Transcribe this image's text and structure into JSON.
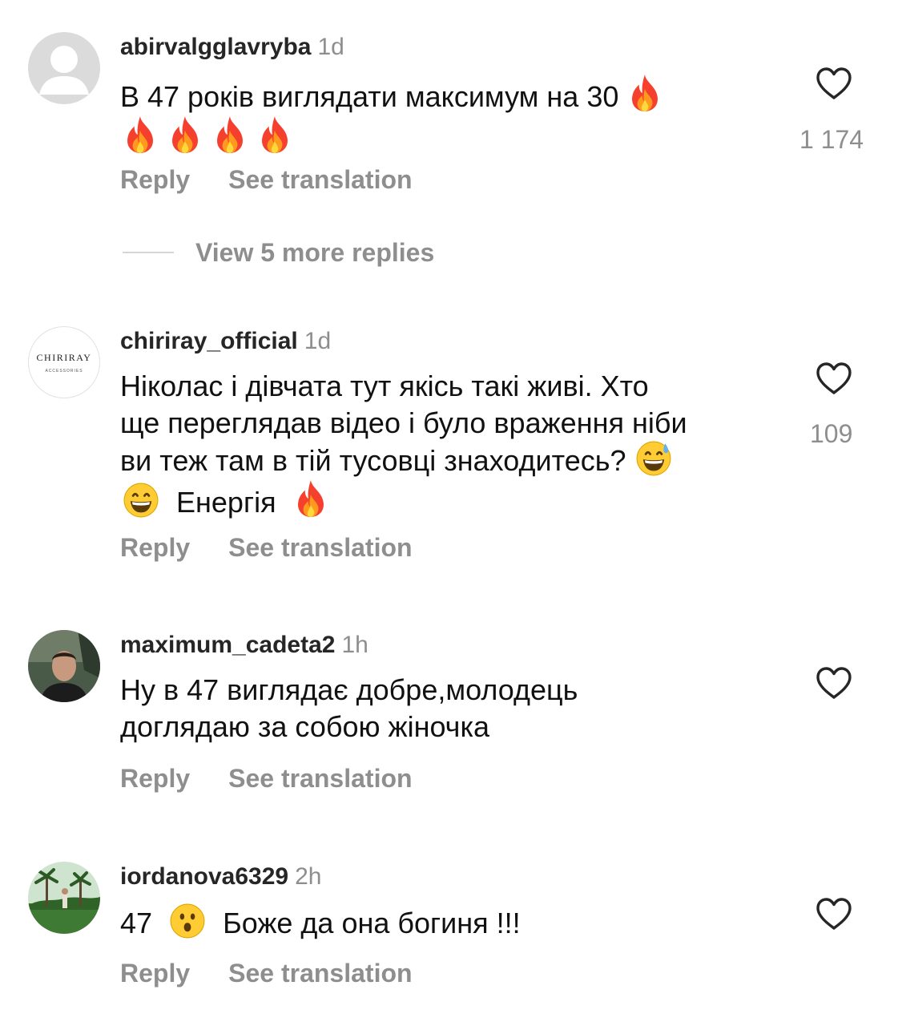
{
  "comments": [
    {
      "username": "abirvalgglavryba",
      "time": "1d",
      "text": "В 47 років виглядати максимум на 30",
      "likes": "1 174",
      "reply_label": "Reply",
      "translate_label": "See translation",
      "view_replies_label": "View 5 more replies",
      "avatar_icon": "default-profile-icon"
    },
    {
      "username": "chiriray_official",
      "time": "1d",
      "text_line1": "Ніколас і дівчата тут якісь такі живі. Хто",
      "text_line2": "ще переглядав відео і було враження ніби",
      "text_line3": "ви теж там в тій тусовці знаходитесь?",
      "text_line4": "Енергія",
      "likes": "109",
      "reply_label": "Reply",
      "translate_label": "See translation",
      "avatar_brand": "CHIRIRAY",
      "avatar_brand_sub": "ACCESSORIES"
    },
    {
      "username": "maximum_cadeta2",
      "time": "1h",
      "text_line1": "Ну в 47 виглядає добре,молодець",
      "text_line2": "доглядаю за собою жіночка",
      "reply_label": "Reply",
      "translate_label": "See translation"
    },
    {
      "username": "iordanova6329",
      "time": "2h",
      "text_before": "47",
      "text_after": "Боже да она богиня !!!",
      "reply_label": "Reply",
      "translate_label": "See translation"
    }
  ],
  "icons": {
    "like": "heart-outline-icon",
    "fire": "fire-emoji",
    "grin_sweat": "grinning-sweat-emoji",
    "grin": "grinning-emoji",
    "surprised": "surprised-emoji"
  },
  "colors": {
    "text": "#111111",
    "secondary": "#8e8e8e",
    "username": "#262626"
  }
}
